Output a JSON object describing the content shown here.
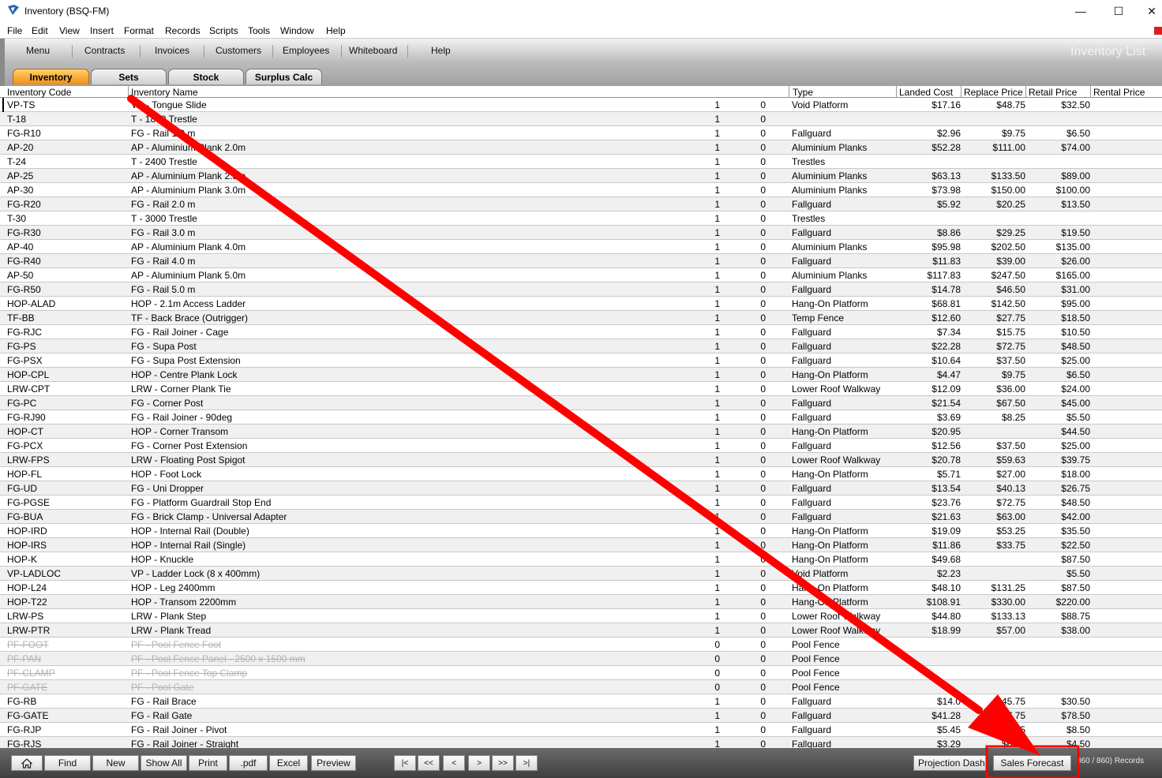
{
  "window": {
    "title": "Inventory (BSQ-FM)",
    "min_glyph": "—",
    "max_glyph": "☐",
    "close_glyph": "✕"
  },
  "menu": [
    "File",
    "Edit",
    "View",
    "Insert",
    "Format",
    "Records",
    "Scripts",
    "Tools",
    "Window",
    "Help"
  ],
  "nav": {
    "items": [
      "Menu",
      "Contracts",
      "Invoices",
      "Customers",
      "Employees",
      "Whiteboard",
      "Help"
    ],
    "title": "Inventory List"
  },
  "tabs": [
    {
      "label": "Inventory",
      "active": true
    },
    {
      "label": "Sets",
      "active": false
    },
    {
      "label": "Stock",
      "active": false
    },
    {
      "label": "Surplus Calc",
      "active": false
    }
  ],
  "columns": {
    "code": "Inventory Code",
    "name": "Inventory Name",
    "type": "Type",
    "landed": "Landed Cost",
    "replace": "Replace Price",
    "retail": "Retail Price",
    "rental": "Rental Price"
  },
  "rows": [
    {
      "code": "VP-TS",
      "name": "VP - Tongue Slide",
      "q1": "1",
      "q2": "0",
      "type": "Void Platform",
      "landed": "$17.16",
      "replace": "$48.75",
      "retail": "$32.50"
    },
    {
      "code": "T-18",
      "name": "T - 1800 Trestle",
      "q1": "1",
      "q2": "0",
      "type": "",
      "landed": "",
      "replace": "",
      "retail": ""
    },
    {
      "code": "FG-R10",
      "name": "FG - Rail 1.0 m",
      "q1": "1",
      "q2": "0",
      "type": "Fallguard",
      "landed": "$2.96",
      "replace": "$9.75",
      "retail": "$6.50"
    },
    {
      "code": "AP-20",
      "name": "AP - Aluminium Plank 2.0m",
      "q1": "1",
      "q2": "0",
      "type": "Aluminium Planks",
      "landed": "$52.28",
      "replace": "$111.00",
      "retail": "$74.00"
    },
    {
      "code": "T-24",
      "name": "T - 2400 Trestle",
      "q1": "1",
      "q2": "0",
      "type": "Trestles",
      "landed": "",
      "replace": "",
      "retail": ""
    },
    {
      "code": "AP-25",
      "name": "AP - Aluminium Plank 2.5m",
      "q1": "1",
      "q2": "0",
      "type": "Aluminium Planks",
      "landed": "$63.13",
      "replace": "$133.50",
      "retail": "$89.00"
    },
    {
      "code": "AP-30",
      "name": "AP - Aluminium Plank 3.0m",
      "q1": "1",
      "q2": "0",
      "type": "Aluminium Planks",
      "landed": "$73.98",
      "replace": "$150.00",
      "retail": "$100.00"
    },
    {
      "code": "FG-R20",
      "name": "FG - Rail 2.0 m",
      "q1": "1",
      "q2": "0",
      "type": "Fallguard",
      "landed": "$5.92",
      "replace": "$20.25",
      "retail": "$13.50"
    },
    {
      "code": "T-30",
      "name": "T - 3000 Trestle",
      "q1": "1",
      "q2": "0",
      "type": "Trestles",
      "landed": "",
      "replace": "",
      "retail": ""
    },
    {
      "code": "FG-R30",
      "name": "FG - Rail 3.0 m",
      "q1": "1",
      "q2": "0",
      "type": "Fallguard",
      "landed": "$8.86",
      "replace": "$29.25",
      "retail": "$19.50"
    },
    {
      "code": "AP-40",
      "name": "AP - Aluminium Plank 4.0m",
      "q1": "1",
      "q2": "0",
      "type": "Aluminium Planks",
      "landed": "$95.98",
      "replace": "$202.50",
      "retail": "$135.00"
    },
    {
      "code": "FG-R40",
      "name": "FG - Rail 4.0 m",
      "q1": "1",
      "q2": "0",
      "type": "Fallguard",
      "landed": "$11.83",
      "replace": "$39.00",
      "retail": "$26.00"
    },
    {
      "code": "AP-50",
      "name": "AP - Aluminium Plank 5.0m",
      "q1": "1",
      "q2": "0",
      "type": "Aluminium Planks",
      "landed": "$117.83",
      "replace": "$247.50",
      "retail": "$165.00"
    },
    {
      "code": "FG-R50",
      "name": "FG - Rail 5.0 m",
      "q1": "1",
      "q2": "0",
      "type": "Fallguard",
      "landed": "$14.78",
      "replace": "$46.50",
      "retail": "$31.00"
    },
    {
      "code": "HOP-ALAD",
      "name": "HOP - 2.1m Access Ladder",
      "q1": "1",
      "q2": "0",
      "type": "Hang-On Platform",
      "landed": "$68.81",
      "replace": "$142.50",
      "retail": "$95.00"
    },
    {
      "code": "TF-BB",
      "name": "TF - Back Brace (Outrigger)",
      "q1": "1",
      "q2": "0",
      "type": "Temp Fence",
      "landed": "$12.60",
      "replace": "$27.75",
      "retail": "$18.50"
    },
    {
      "code": "FG-RJC",
      "name": "FG - Rail Joiner - Cage",
      "q1": "1",
      "q2": "0",
      "type": "Fallguard",
      "landed": "$7.34",
      "replace": "$15.75",
      "retail": "$10.50"
    },
    {
      "code": "FG-PS",
      "name": "FG - Supa Post",
      "q1": "1",
      "q2": "0",
      "type": "Fallguard",
      "landed": "$22.28",
      "replace": "$72.75",
      "retail": "$48.50"
    },
    {
      "code": "FG-PSX",
      "name": "FG - Supa Post Extension",
      "q1": "1",
      "q2": "0",
      "type": "Fallguard",
      "landed": "$10.64",
      "replace": "$37.50",
      "retail": "$25.00"
    },
    {
      "code": "HOP-CPL",
      "name": "HOP - Centre Plank Lock",
      "q1": "1",
      "q2": "0",
      "type": "Hang-On Platform",
      "landed": "$4.47",
      "replace": "$9.75",
      "retail": "$6.50"
    },
    {
      "code": "LRW-CPT",
      "name": "LRW - Corner Plank Tie",
      "q1": "1",
      "q2": "0",
      "type": "Lower Roof Walkway",
      "landed": "$12.09",
      "replace": "$36.00",
      "retail": "$24.00"
    },
    {
      "code": "FG-PC",
      "name": "FG - Corner Post",
      "q1": "1",
      "q2": "0",
      "type": "Fallguard",
      "landed": "$21.54",
      "replace": "$67.50",
      "retail": "$45.00"
    },
    {
      "code": "FG-RJ90",
      "name": "FG - Rail Joiner - 90deg",
      "q1": "1",
      "q2": "0",
      "type": "Fallguard",
      "landed": "$3.69",
      "replace": "$8.25",
      "retail": "$5.50"
    },
    {
      "code": "HOP-CT",
      "name": "HOP - Corner Transom",
      "q1": "1",
      "q2": "0",
      "type": "Hang-On Platform",
      "landed": "$20.95",
      "replace": "",
      "retail": "$44.50"
    },
    {
      "code": "FG-PCX",
      "name": "FG - Corner Post Extension",
      "q1": "1",
      "q2": "0",
      "type": "Fallguard",
      "landed": "$12.56",
      "replace": "$37.50",
      "retail": "$25.00"
    },
    {
      "code": "LRW-FPS",
      "name": "LRW - Floating Post Spigot",
      "q1": "1",
      "q2": "0",
      "type": "Lower Roof Walkway",
      "landed": "$20.78",
      "replace": "$59.63",
      "retail": "$39.75"
    },
    {
      "code": "HOP-FL",
      "name": "HOP - Foot Lock",
      "q1": "1",
      "q2": "0",
      "type": "Hang-On Platform",
      "landed": "$5.71",
      "replace": "$27.00",
      "retail": "$18.00"
    },
    {
      "code": "FG-UD",
      "name": "FG - Uni Dropper",
      "q1": "1",
      "q2": "0",
      "type": "Fallguard",
      "landed": "$13.54",
      "replace": "$40.13",
      "retail": "$26.75"
    },
    {
      "code": "FG-PGSE",
      "name": "FG - Platform Guardrail Stop End",
      "q1": "1",
      "q2": "0",
      "type": "Fallguard",
      "landed": "$23.76",
      "replace": "$72.75",
      "retail": "$48.50"
    },
    {
      "code": "FG-BUA",
      "name": "FG - Brick Clamp - Universal Adapter",
      "q1": "1",
      "q2": "0",
      "type": "Fallguard",
      "landed": "$21.63",
      "replace": "$63.00",
      "retail": "$42.00"
    },
    {
      "code": "HOP-IRD",
      "name": "HOP - Internal Rail (Double)",
      "q1": "1",
      "q2": "0",
      "type": "Hang-On Platform",
      "landed": "$19.09",
      "replace": "$53.25",
      "retail": "$35.50"
    },
    {
      "code": "HOP-IRS",
      "name": "HOP - Internal Rail (Single)",
      "q1": "1",
      "q2": "0",
      "type": "Hang-On Platform",
      "landed": "$11.86",
      "replace": "$33.75",
      "retail": "$22.50"
    },
    {
      "code": "HOP-K",
      "name": "HOP - Knuckle",
      "q1": "1",
      "q2": "0",
      "type": "Hang-On Platform",
      "landed": "$49.68",
      "replace": "",
      "retail": "$87.50"
    },
    {
      "code": "VP-LADLOC",
      "name": "VP - Ladder Lock (8 x 400mm)",
      "q1": "1",
      "q2": "0",
      "type": "Void Platform",
      "landed": "$2.23",
      "replace": "",
      "retail": "$5.50"
    },
    {
      "code": "HOP-L24",
      "name": "HOP - Leg 2400mm",
      "q1": "1",
      "q2": "0",
      "type": "Hang-On Platform",
      "landed": "$48.10",
      "replace": "$131.25",
      "retail": "$87.50"
    },
    {
      "code": "HOP-T22",
      "name": "HOP - Transom 2200mm",
      "q1": "1",
      "q2": "0",
      "type": "Hang-On Platform",
      "landed": "$108.91",
      "replace": "$330.00",
      "retail": "$220.00"
    },
    {
      "code": "LRW-PS",
      "name": "LRW - Plank Step",
      "q1": "1",
      "q2": "0",
      "type": "Lower Roof Walkway",
      "landed": "$44.80",
      "replace": "$133.13",
      "retail": "$88.75"
    },
    {
      "code": "LRW-PTR",
      "name": "LRW - Plank Tread",
      "q1": "1",
      "q2": "0",
      "type": "Lower Roof Walkway",
      "landed": "$18.99",
      "replace": "$57.00",
      "retail": "$38.00"
    },
    {
      "code": "PF-FOOT",
      "name": "PF - Pool Fence Foot",
      "q1": "0",
      "q2": "0",
      "type": "Pool Fence",
      "landed": "",
      "replace": "",
      "retail": "",
      "strike": true
    },
    {
      "code": "PF-PAN",
      "name": "PF - Pool Fence Panel - 2500 x 1500 mm",
      "q1": "0",
      "q2": "0",
      "type": "Pool Fence",
      "landed": "",
      "replace": "",
      "retail": "",
      "strike": true
    },
    {
      "code": "PF-CLAMP",
      "name": "PF - Pool Fence Top Clamp",
      "q1": "0",
      "q2": "0",
      "type": "Pool Fence",
      "landed": "",
      "replace": "",
      "retail": "",
      "strike": true
    },
    {
      "code": "PF-GATE",
      "name": "PF - Pool Gate",
      "q1": "0",
      "q2": "0",
      "type": "Pool Fence",
      "landed": "",
      "replace": "",
      "retail": "",
      "strike": true
    },
    {
      "code": "FG-RB",
      "name": "FG - Rail Brace",
      "q1": "1",
      "q2": "0",
      "type": "Fallguard",
      "landed": "$14.0",
      "replace": "$45.75",
      "retail": "$30.50"
    },
    {
      "code": "FG-GATE",
      "name": "FG - Rail Gate",
      "q1": "1",
      "q2": "0",
      "type": "Fallguard",
      "landed": "$41.28",
      "replace": "$117.75",
      "retail": "$78.50"
    },
    {
      "code": "FG-RJP",
      "name": "FG - Rail Joiner - Pivot",
      "q1": "1",
      "q2": "0",
      "type": "Fallguard",
      "landed": "$5.45",
      "replace": "$12.75",
      "retail": "$8.50"
    },
    {
      "code": "FG-RJS",
      "name": "FG - Rail Joiner - Straight",
      "q1": "1",
      "q2": "0",
      "type": "Fallguard",
      "landed": "$3.29",
      "replace": "$6.75",
      "retail": "$4.50"
    }
  ],
  "footer": {
    "home_icon": "home-icon",
    "buttons": [
      "Find",
      "New",
      "Show All",
      "Print",
      ".pdf",
      "Excel",
      "Preview"
    ],
    "pager": [
      "|<",
      "<<",
      "<",
      ">",
      ">>",
      ">|"
    ],
    "projection": "Projection Dash",
    "sales_forecast": "Sales Forecast",
    "records": "860 / 860) Records"
  },
  "annotation": {
    "arrow_color": "#ff0000",
    "highlight_target": "Sales Forecast"
  }
}
